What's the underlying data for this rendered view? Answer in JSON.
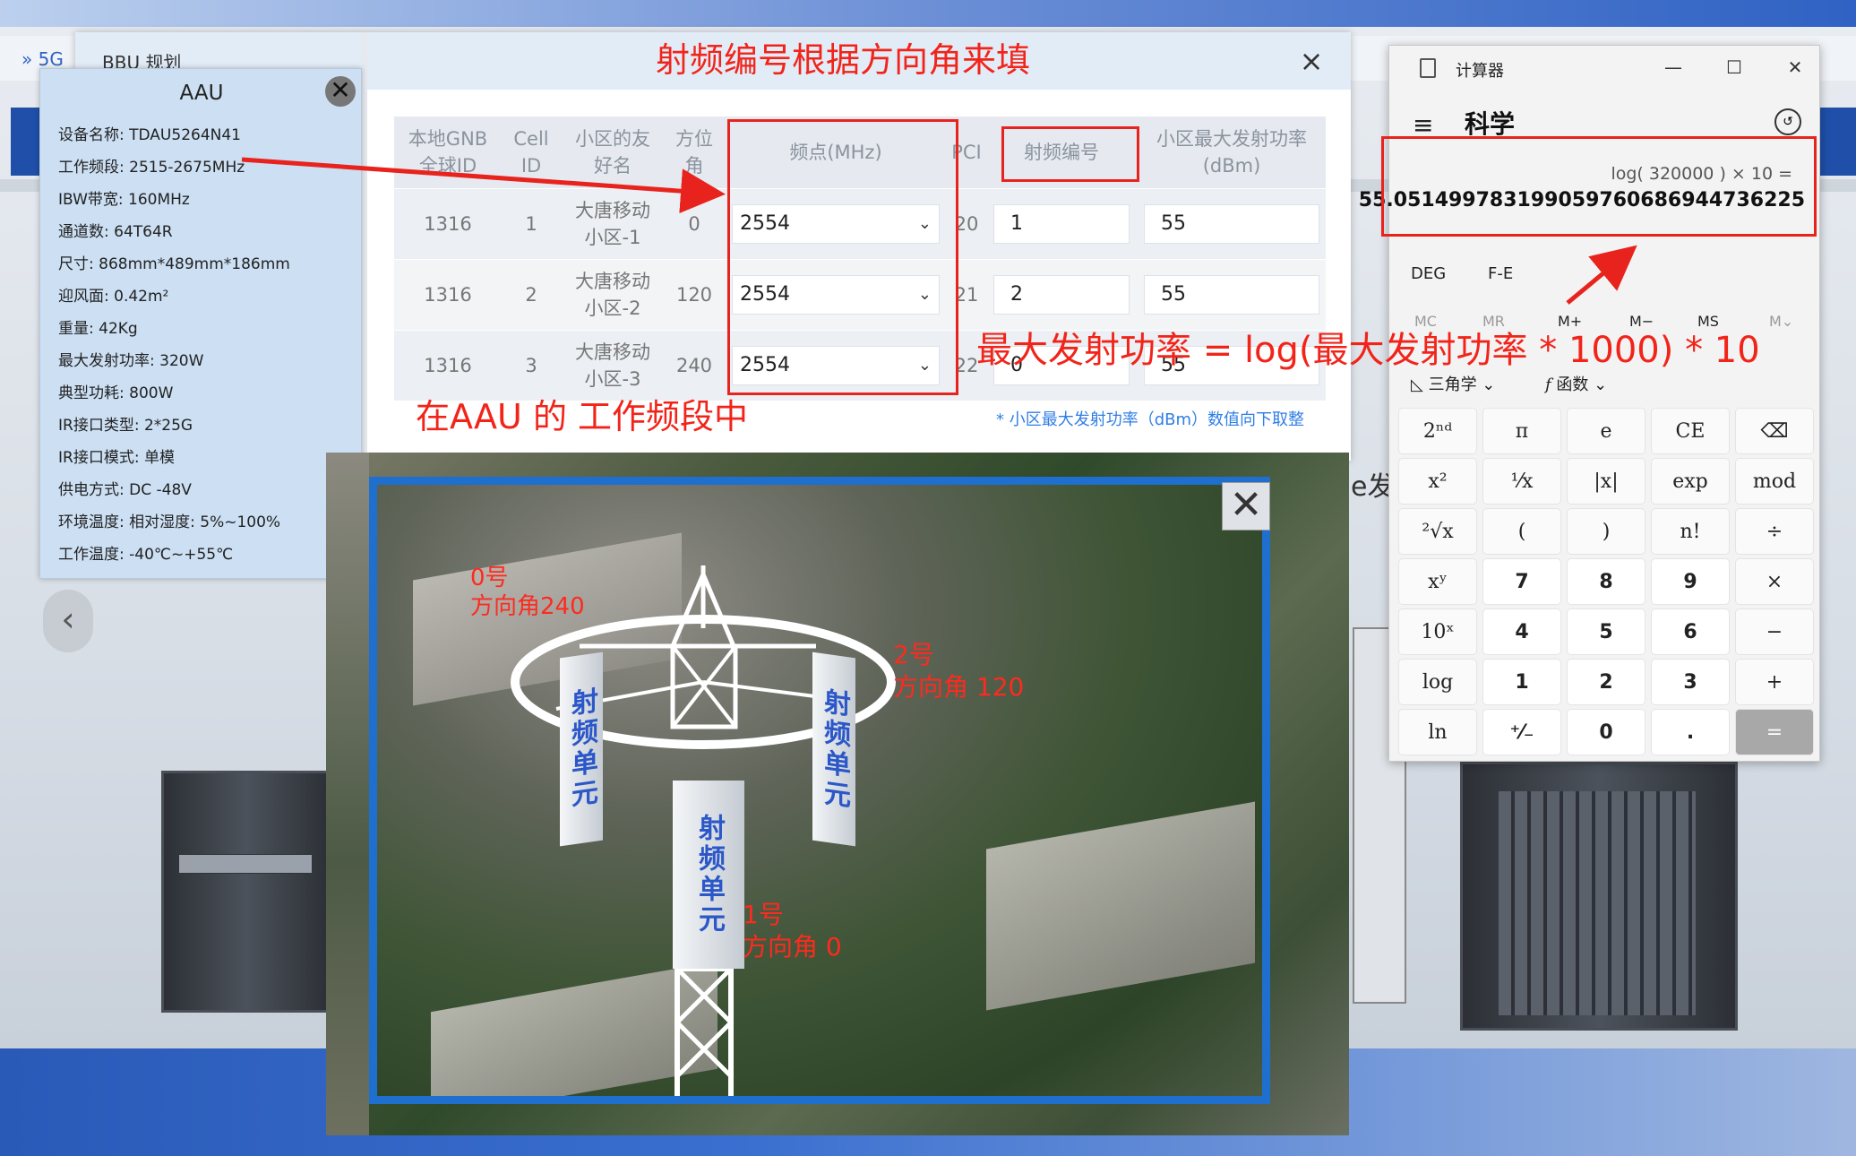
{
  "background": {
    "breadcrumb": "» 5G",
    "partial_text": "e发",
    "nav_arrow": "‹"
  },
  "plan_dialog": {
    "title": "BBU 规划",
    "close": "×",
    "headers": [
      "本地GNB全球ID",
      "Cell ID",
      "小区的友好名",
      "方位角",
      "频点(MHz)",
      "PCI",
      "射频编号",
      "小区最大发射功率(dBm)"
    ],
    "header_lines": {
      "gnb": [
        "本地GNB",
        "全球ID"
      ],
      "cell": [
        "Cell",
        "ID"
      ],
      "name": [
        "小区的友",
        "好名"
      ],
      "azimuth": [
        "方位",
        "角"
      ],
      "freq": "频点(MHz)",
      "pci": "PCI",
      "rf": "射频编号",
      "power": [
        "小区最大发射功率",
        "(dBm)"
      ]
    },
    "rows": [
      {
        "gnb": "1316",
        "cell": "1",
        "name1": "大唐移动",
        "name2": "小区-1",
        "azimuth": "0",
        "freq": "2554",
        "pci": "20",
        "rf": "1",
        "power": "55"
      },
      {
        "gnb": "1316",
        "cell": "2",
        "name1": "大唐移动",
        "name2": "小区-2",
        "azimuth": "120",
        "freq": "2554",
        "pci": "21",
        "rf": "2",
        "power": "55"
      },
      {
        "gnb": "1316",
        "cell": "3",
        "name1": "大唐移动",
        "name2": "小区-3",
        "azimuth": "240",
        "freq": "2554",
        "pci": "22",
        "rf": "0",
        "power": "55"
      }
    ],
    "note": "* 小区最大发射功率（dBm）数值向下取整"
  },
  "aau_panel": {
    "title": "AAU",
    "close": "✕",
    "items": [
      "设备名称: TDAU5264N41",
      "工作频段: 2515-2675MHz",
      "IBW带宽: 160MHz",
      "通道数: 64T64R",
      "尺寸: 868mm*489mm*186mm",
      "迎风面: 0.42m²",
      "重量: 42Kg",
      "最大发射功率: 320W",
      "典型功耗: 800W",
      "IR接口类型: 2*25G",
      "IR接口模式: 单模",
      "供电方式: DC -48V",
      "环境温度: 相对湿度: 5%~100%",
      "工作温度: -40℃~+55℃"
    ]
  },
  "photo_popup": {
    "close": "✕",
    "antenna_text": "射频单元",
    "labels": {
      "unit0": [
        "0号",
        "方向角240"
      ],
      "unit2": [
        "2号",
        "方向角 120"
      ],
      "unit1": [
        "1号",
        "方向角 0"
      ]
    }
  },
  "calculator": {
    "app_title": "计算器",
    "mode": "科学",
    "expression": "log( 320000 ) × 10 =",
    "result": "55.051499783199059760686944736225",
    "angle_unit": "DEG",
    "fe": "F-E",
    "memory": [
      "MC",
      "MR",
      "M+",
      "M−",
      "MS",
      "M⌄"
    ],
    "trig": "三角学",
    "func": "函数",
    "keys": [
      {
        "label": "2ⁿᵈ",
        "type": "fn"
      },
      {
        "label": "π",
        "type": "fn"
      },
      {
        "label": "e",
        "type": "fn"
      },
      {
        "label": "CE",
        "type": "fn"
      },
      {
        "label": "⌫",
        "type": "fn"
      },
      {
        "label": "x²",
        "type": "fn"
      },
      {
        "label": "¹⁄x",
        "type": "fn"
      },
      {
        "label": "|x|",
        "type": "fn"
      },
      {
        "label": "exp",
        "type": "fn"
      },
      {
        "label": "mod",
        "type": "fn"
      },
      {
        "label": "²√x",
        "type": "fn"
      },
      {
        "label": "(",
        "type": "fn"
      },
      {
        "label": ")",
        "type": "fn"
      },
      {
        "label": "n!",
        "type": "fn"
      },
      {
        "label": "÷",
        "type": "fn"
      },
      {
        "label": "xʸ",
        "type": "fn"
      },
      {
        "label": "7",
        "type": "num"
      },
      {
        "label": "8",
        "type": "num"
      },
      {
        "label": "9",
        "type": "num"
      },
      {
        "label": "×",
        "type": "fn"
      },
      {
        "label": "10ˣ",
        "type": "fn"
      },
      {
        "label": "4",
        "type": "num"
      },
      {
        "label": "5",
        "type": "num"
      },
      {
        "label": "6",
        "type": "num"
      },
      {
        "label": "−",
        "type": "fn"
      },
      {
        "label": "log",
        "type": "fn"
      },
      {
        "label": "1",
        "type": "num"
      },
      {
        "label": "2",
        "type": "num"
      },
      {
        "label": "3",
        "type": "num"
      },
      {
        "label": "+",
        "type": "fn"
      },
      {
        "label": "ln",
        "type": "fn"
      },
      {
        "label": "⁺⁄₋",
        "type": "num"
      },
      {
        "label": "0",
        "type": "num"
      },
      {
        "label": ".",
        "type": "num"
      },
      {
        "label": "=",
        "type": "eq"
      }
    ]
  },
  "annotations": {
    "title_note": "射频编号根据方向角来填",
    "formula": "最大发射功率 = log(最大发射功率 * 1000)   * 10",
    "working_band": "在AAU 的 工作频段中"
  },
  "colors": {
    "annotation_red": "#e8231d",
    "link_blue": "#2f7ee6",
    "photo_border": "#1e6fce",
    "antenna_text": "#2b57c9"
  }
}
